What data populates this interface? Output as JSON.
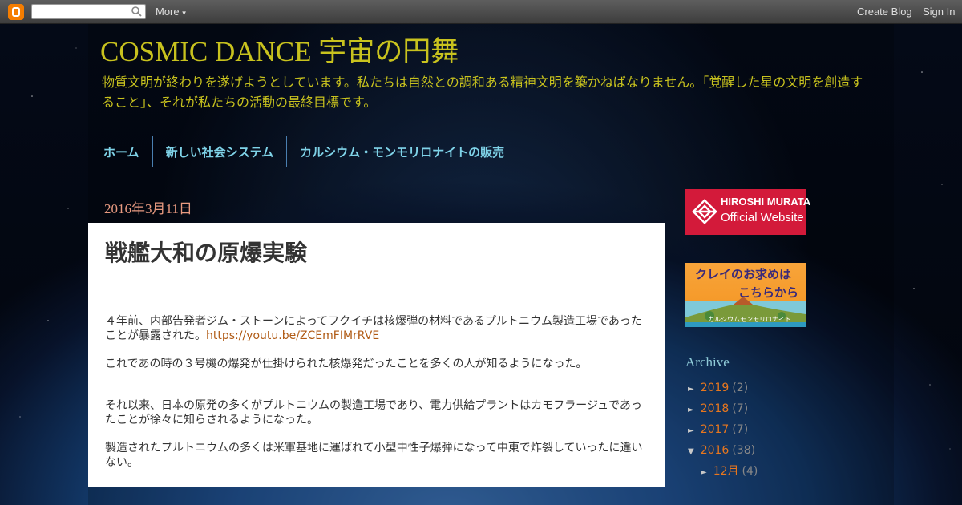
{
  "navbar": {
    "more": "More",
    "create_blog": "Create Blog",
    "sign_in": "Sign In"
  },
  "header": {
    "title": "COSMIC DANCE 宇宙の円舞",
    "description": "物質文明が終わりを遂げようとしています。私たちは自然との調和ある精神文明を築かねばなりません。「覚醒した星の文明を創造すること」、それが私たちの活動の最終目標です。"
  },
  "tabs": [
    {
      "label": "ホーム"
    },
    {
      "label": "新しい社会システム"
    },
    {
      "label": "カルシウム・モンモリロナイトの販売"
    }
  ],
  "post": {
    "date": "2016年3月11日",
    "title": "戦艦大和の原爆実験",
    "p1": "４年前、内部告発者ジム・ストーンによってフクイチは核爆弾の材料であるプルトニウム製造工場であったことが暴露された。",
    "p1_link": "https://youtu.be/ZCEmFIMrRVE",
    "p2": "これであの時の３号機の爆発が仕掛けられた核爆発だったことを多くの人が知るようになった。",
    "p3": "それ以来、日本の原発の多くがプルトニウムの製造工場であり、電力供給プラントはカモフラージュであったことが徐々に知らされるようになった。",
    "p4": "製造されたプルトニウムの多くは米軍基地に運ばれて小型中性子爆弾になって中東で炸裂していったに違いない。"
  },
  "sidebar": {
    "murata": {
      "line1": "HIROSHI MURATA",
      "line2": "Official Website"
    },
    "clay": {
      "line1": "クレイのお求めは",
      "line2": "こちらから",
      "line3": "カルシウムモンモリロナイト"
    },
    "archive_title": "Archive",
    "archive": [
      {
        "toggle": "►",
        "label": "2019",
        "count": "(2)"
      },
      {
        "toggle": "►",
        "label": "2018",
        "count": "(7)"
      },
      {
        "toggle": "►",
        "label": "2017",
        "count": "(7)"
      },
      {
        "toggle": "▼",
        "label": "2016",
        "count": "(38)"
      },
      {
        "toggle": "►",
        "label": "12月",
        "count": "(4)"
      }
    ]
  },
  "colors": {
    "title": "#c8c21e",
    "tab": "#7fd3e8",
    "date": "#e89a80",
    "link": "#b05a14",
    "archive_year": "#e8771e",
    "murata_bg": "#d31a3a"
  }
}
